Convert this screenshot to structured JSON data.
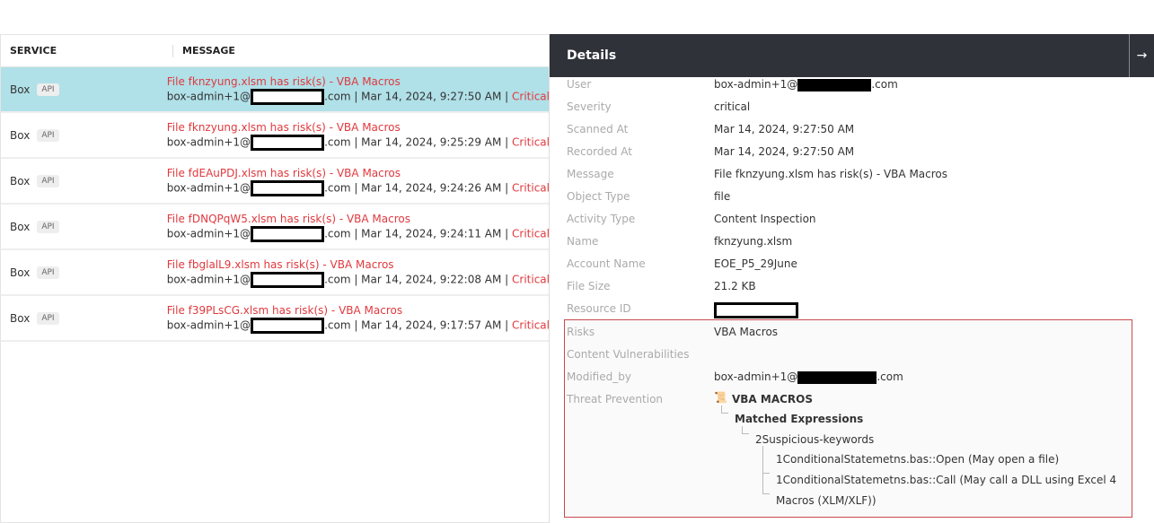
{
  "table": {
    "headers": {
      "service": "SERVICE",
      "message": "MESSAGE"
    },
    "rows": [
      {
        "service": "Box",
        "badge": "API",
        "title": "File fknzyung.xlsm has risk(s) - VBA Macros",
        "user_prefix": "box-admin+1@",
        "user_suffix": ".com | Mar 14, 2024, 9:27:50 AM | ",
        "severity": "Critical",
        "selected": true
      },
      {
        "service": "Box",
        "badge": "API",
        "title": "File fknzyung.xlsm has risk(s) - VBA Macros",
        "user_prefix": "box-admin+1@",
        "user_suffix": ".com | Mar 14, 2024, 9:25:29 AM | ",
        "severity": "Critical"
      },
      {
        "service": "Box",
        "badge": "API",
        "title": "File fdEAuPDJ.xlsm has risk(s) - VBA Macros",
        "user_prefix": "box-admin+1@",
        "user_suffix": ".com | Mar 14, 2024, 9:24:26 AM | ",
        "severity": "Critical"
      },
      {
        "service": "Box",
        "badge": "API",
        "title": "File fDNQPqW5.xlsm has risk(s) - VBA Macros",
        "user_prefix": "box-admin+1@",
        "user_suffix": ".com | Mar 14, 2024, 9:24:11 AM | ",
        "severity": "Critical"
      },
      {
        "service": "Box",
        "badge": "API",
        "title": "File fbglalL9.xlsm has risk(s) - VBA Macros",
        "user_prefix": "box-admin+1@",
        "user_suffix": ".com | Mar 14, 2024, 9:22:08 AM | ",
        "severity": "Critical"
      },
      {
        "service": "Box",
        "badge": "API",
        "title": "File f39PLsCG.xlsm has risk(s) - VBA Macros",
        "user_prefix": "box-admin+1@",
        "user_suffix": ".com | Mar 14, 2024, 9:17:57 AM | ",
        "severity": "Critical"
      }
    ]
  },
  "details": {
    "title": "Details",
    "close_icon": "arrow-right-icon",
    "fields": [
      {
        "label": "User",
        "prefix": "box-admin+1@",
        "suffix": ".com"
      },
      {
        "label": "Severity",
        "value": "critical"
      },
      {
        "label": "Scanned At",
        "value": "Mar 14, 2024, 9:27:50 AM"
      },
      {
        "label": "Recorded At",
        "value": "Mar 14, 2024, 9:27:50 AM"
      },
      {
        "label": "Message",
        "value": "File fknzyung.xlsm has risk(s) - VBA Macros"
      },
      {
        "label": "Object Type",
        "value": "file"
      },
      {
        "label": "Activity Type",
        "value": "Content Inspection"
      },
      {
        "label": "Name",
        "value": "fknzyung.xlsm"
      },
      {
        "label": "Account Name",
        "value": "EOE_P5_29June"
      },
      {
        "label": "File Size",
        "value": "21.2 KB"
      },
      {
        "label": "Resource ID"
      }
    ],
    "risk": {
      "risks_label": "Risks",
      "risks_value": "VBA Macros",
      "vuln_label": "Content Vulnerabilities",
      "modified_label": "Modified_by",
      "modified_prefix": "box-admin+1@",
      "modified_suffix": ".com",
      "threat_label": "Threat Prevention",
      "tree": {
        "root": "VBA MACROS",
        "matched": "Matched Expressions",
        "group": "2Suspicious-keywords",
        "items": [
          "1ConditionalStatemetns.bas::Open (May open a file)",
          "1ConditionalStatemetns.bas::Call (May call a DLL using Excel 4",
          "Macros (XLM/XLF))"
        ]
      }
    }
  }
}
